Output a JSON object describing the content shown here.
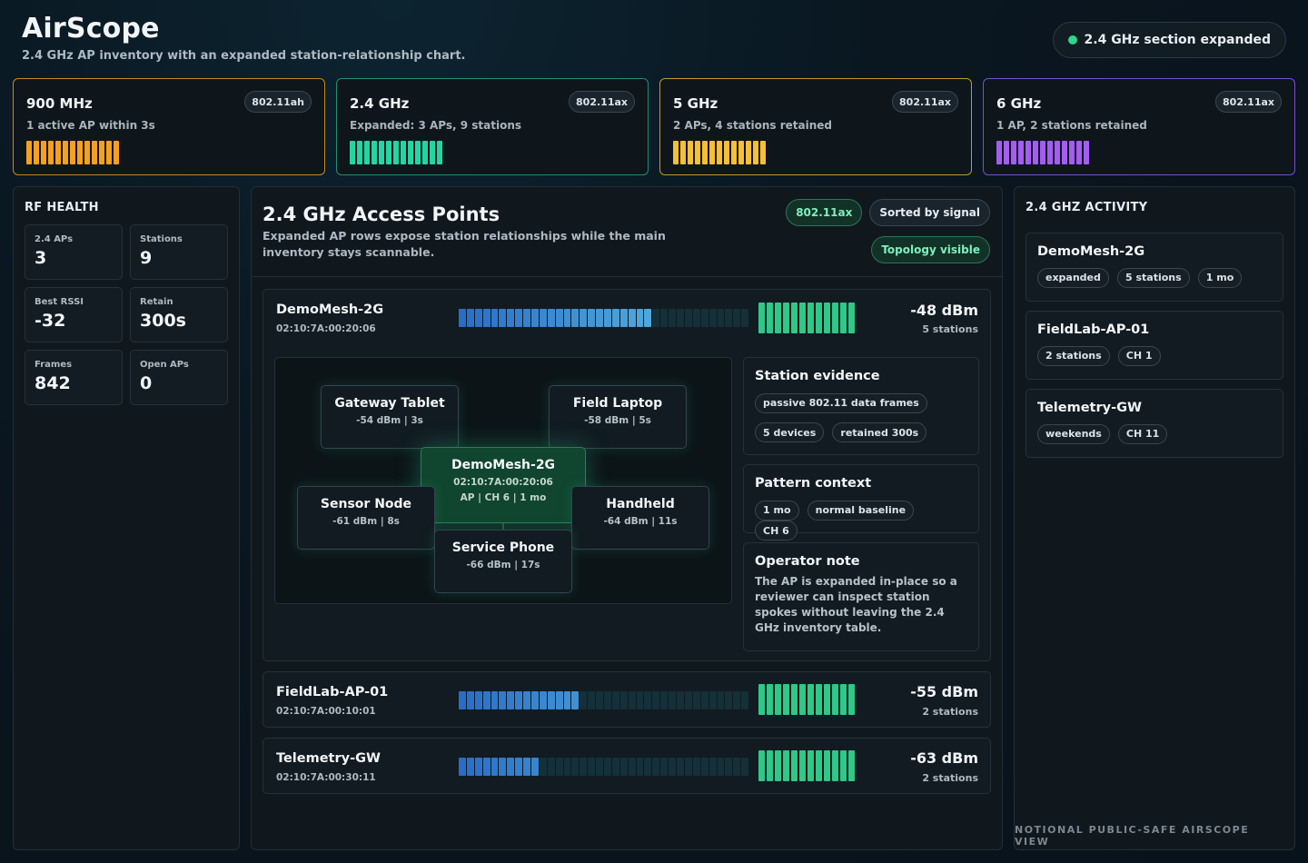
{
  "app": {
    "title": "AirScope",
    "subtitle": "2.4 GHz AP inventory with an expanded station-relationship chart.",
    "status": "2.4 GHz section expanded",
    "footer": "NOTIONAL PUBLIC-SAFE AIRSCOPE VIEW"
  },
  "bands": [
    {
      "name": "900 MHz",
      "std": "802.11ah",
      "desc": "1 active AP within 3s",
      "color": "#f5a020",
      "border": "#c8861c"
    },
    {
      "name": "2.4 GHz",
      "std": "802.11ax",
      "desc": "Expanded: 3 APs, 9 stations",
      "color": "#22d6a4",
      "border": "#1f8f6c"
    },
    {
      "name": "5 GHz",
      "std": "802.11ax",
      "desc": "2 APs, 4 stations retained",
      "color": "#f7bf35",
      "border": "#c89722"
    },
    {
      "name": "6 GHz",
      "std": "802.11ax",
      "desc": "1 AP, 2 stations retained",
      "color": "#a55cf2",
      "border": "#7d4bd0"
    }
  ],
  "rf_health": {
    "heading": "RF HEALTH",
    "stats": [
      {
        "label": "2.4 APs",
        "value": "3"
      },
      {
        "label": "Stations",
        "value": "9"
      },
      {
        "label": "Best RSSI",
        "value": "-32"
      },
      {
        "label": "Retain",
        "value": "300s"
      },
      {
        "label": "Frames",
        "value": "842"
      },
      {
        "label": "Open APs",
        "value": "0"
      }
    ]
  },
  "main": {
    "title": "2.4 GHz Access Points",
    "subtitle": "Expanded AP rows expose station relationships while the main inventory stays scannable.",
    "chip_standard": "802.11ax",
    "chip_sort": "Sorted by signal",
    "chip_topology": "Topology visible",
    "aps": [
      {
        "name": "DemoMesh-2G",
        "mac": "02:10:7A:00:20:06",
        "dbm": "-48 dBm",
        "stations": "5 stations",
        "signal": 0.68
      },
      {
        "name": "FieldLab-AP-01",
        "mac": "02:10:7A:00:10:01",
        "dbm": "-55 dBm",
        "stations": "2 stations",
        "signal": 0.43
      },
      {
        "name": "Telemetry-GW",
        "mac": "02:10:7A:00:30:11",
        "dbm": "-63 dBm",
        "stations": "2 stations",
        "signal": 0.28
      }
    ],
    "topology": {
      "hub": {
        "name": "DemoMesh-2G",
        "mac": "02:10:7A:00:20:06",
        "meta": "AP | CH 6 | 1 mo"
      },
      "nodes": [
        {
          "name": "Gateway Tablet",
          "meta": "-54 dBm | 3s"
        },
        {
          "name": "Field Laptop",
          "meta": "-58 dBm | 5s"
        },
        {
          "name": "Sensor Node",
          "meta": "-61 dBm | 8s"
        },
        {
          "name": "Handheld",
          "meta": "-64 dBm | 11s"
        },
        {
          "name": "Service Phone",
          "meta": "-66 dBm | 17s"
        }
      ]
    },
    "evidence": {
      "title": "Station evidence",
      "chips": [
        "passive 802.11 data frames",
        "5 devices",
        "retained 300s"
      ]
    },
    "pattern": {
      "title": "Pattern context",
      "chips": [
        "1 mo",
        "normal baseline",
        "CH 6"
      ]
    },
    "note": {
      "title": "Operator note",
      "text": "The AP is expanded in-place so a reviewer can inspect station spokes without leaving the 2.4 GHz inventory table."
    }
  },
  "activity": {
    "heading": "2.4 GHZ ACTIVITY",
    "items": [
      {
        "name": "DemoMesh-2G",
        "chips": [
          "expanded",
          "5 stations",
          "1 mo"
        ]
      },
      {
        "name": "FieldLab-AP-01",
        "chips": [
          "2 stations",
          "CH 1"
        ]
      },
      {
        "name": "Telemetry-GW",
        "chips": [
          "weekends",
          "CH 11"
        ]
      }
    ]
  }
}
